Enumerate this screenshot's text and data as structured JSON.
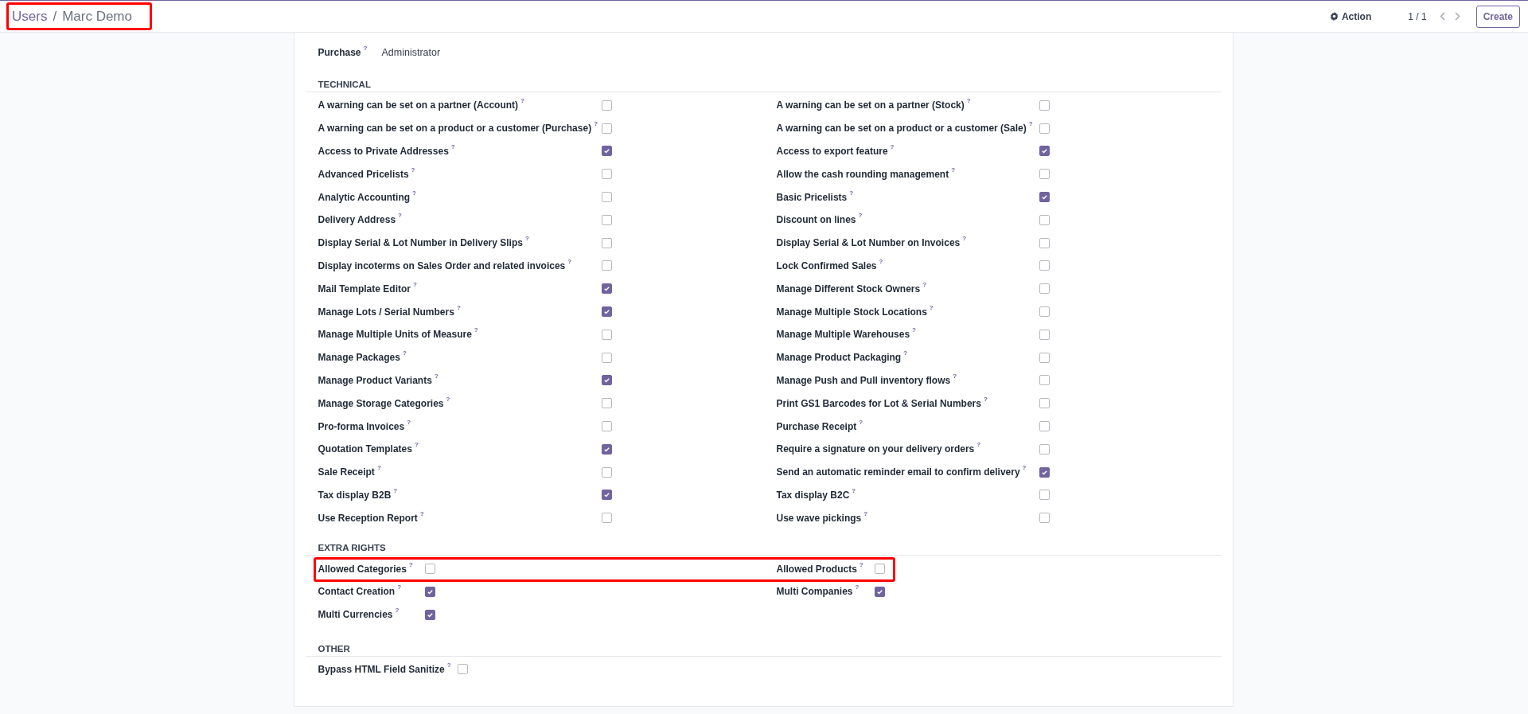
{
  "breadcrumb": {
    "highlighted": true,
    "items": [
      {
        "kind": "link",
        "text": "Users"
      },
      {
        "kind": "separator",
        "text": "/"
      },
      {
        "kind": "current",
        "text": "Marc Demo"
      }
    ]
  },
  "toolbar": {
    "action": "Action",
    "pager": "1 / 1",
    "create": "Create"
  },
  "purchase": {
    "label": "Purchase",
    "help": "?",
    "value": "Administrator"
  },
  "sections": [
    {
      "title": "TECHNICAL",
      "rows": [
        {
          "highlighted": false,
          "fields": [
            {
              "label": "A warning can be set on a partner (Account)",
              "help": "?",
              "checked": false
            },
            {
              "label": "A warning can be set on a partner (Stock)",
              "help": "?",
              "checked": false
            }
          ]
        },
        {
          "highlighted": false,
          "fields": [
            {
              "label": "A warning can be set on a product or a customer (Purchase)",
              "help": "?",
              "checked": false
            },
            {
              "label": "A warning can be set on a product or a customer (Sale)",
              "help": "?",
              "checked": false
            }
          ]
        },
        {
          "highlighted": false,
          "fields": [
            {
              "label": "Access to Private Addresses",
              "help": "?",
              "checked": true
            },
            {
              "label": "Access to export feature",
              "help": "?",
              "checked": true
            }
          ]
        },
        {
          "highlighted": false,
          "fields": [
            {
              "label": "Advanced Pricelists",
              "help": "?",
              "checked": false
            },
            {
              "label": "Allow the cash rounding management",
              "help": "?",
              "checked": false
            }
          ]
        },
        {
          "highlighted": false,
          "fields": [
            {
              "label": "Analytic Accounting",
              "help": "?",
              "checked": false
            },
            {
              "label": "Basic Pricelists",
              "help": "?",
              "checked": true
            }
          ]
        },
        {
          "highlighted": false,
          "fields": [
            {
              "label": "Delivery Address",
              "help": "?",
              "checked": false
            },
            {
              "label": "Discount on lines",
              "help": "?",
              "checked": false
            }
          ]
        },
        {
          "highlighted": false,
          "fields": [
            {
              "label": "Display Serial & Lot Number in Delivery Slips",
              "help": "?",
              "checked": false
            },
            {
              "label": "Display Serial & Lot Number on Invoices",
              "help": "?",
              "checked": false
            }
          ]
        },
        {
          "highlighted": false,
          "fields": [
            {
              "label": "Display incoterms on Sales Order and related invoices",
              "help": "?",
              "checked": false
            },
            {
              "label": "Lock Confirmed Sales",
              "help": "?",
              "checked": false
            }
          ]
        },
        {
          "highlighted": false,
          "fields": [
            {
              "label": "Mail Template Editor",
              "help": "?",
              "checked": true
            },
            {
              "label": "Manage Different Stock Owners",
              "help": "?",
              "checked": false
            }
          ]
        },
        {
          "highlighted": false,
          "fields": [
            {
              "label": "Manage Lots / Serial Numbers",
              "help": "?",
              "checked": true
            },
            {
              "label": "Manage Multiple Stock Locations",
              "help": "?",
              "checked": false
            }
          ]
        },
        {
          "highlighted": false,
          "fields": [
            {
              "label": "Manage Multiple Units of Measure",
              "help": "?",
              "checked": false
            },
            {
              "label": "Manage Multiple Warehouses",
              "help": "?",
              "checked": false
            }
          ]
        },
        {
          "highlighted": false,
          "fields": [
            {
              "label": "Manage Packages",
              "help": "?",
              "checked": false
            },
            {
              "label": "Manage Product Packaging",
              "help": "?",
              "checked": false
            }
          ]
        },
        {
          "highlighted": false,
          "fields": [
            {
              "label": "Manage Product Variants",
              "help": "?",
              "checked": true
            },
            {
              "label": "Manage Push and Pull inventory flows",
              "help": "?",
              "checked": false
            }
          ]
        },
        {
          "highlighted": false,
          "fields": [
            {
              "label": "Manage Storage Categories",
              "help": "?",
              "checked": false
            },
            {
              "label": "Print GS1 Barcodes for Lot & Serial Numbers",
              "help": "?",
              "checked": false
            }
          ]
        },
        {
          "highlighted": false,
          "fields": [
            {
              "label": "Pro-forma Invoices",
              "help": "?",
              "checked": false
            },
            {
              "label": "Purchase Receipt",
              "help": "?",
              "checked": false
            }
          ]
        },
        {
          "highlighted": false,
          "fields": [
            {
              "label": "Quotation Templates",
              "help": "?",
              "checked": true
            },
            {
              "label": "Require a signature on your delivery orders",
              "help": "?",
              "checked": false
            }
          ]
        },
        {
          "highlighted": false,
          "fields": [
            {
              "label": "Sale Receipt",
              "help": "?",
              "checked": false
            },
            {
              "label": "Send an automatic reminder email to confirm delivery",
              "help": "?",
              "checked": true
            }
          ]
        },
        {
          "highlighted": false,
          "fields": [
            {
              "label": "Tax display B2B",
              "help": "?",
              "checked": true
            },
            {
              "label": "Tax display B2C",
              "help": "?",
              "checked": false
            }
          ]
        },
        {
          "highlighted": false,
          "fields": [
            {
              "label": "Use Reception Report",
              "help": "?",
              "checked": false
            },
            {
              "label": "Use wave pickings",
              "help": "?",
              "checked": false
            }
          ]
        }
      ]
    },
    {
      "title": "EXTRA RIGHTS",
      "rows": [
        {
          "highlighted": true,
          "fields": [
            {
              "label": "Allowed Categories",
              "help": "?",
              "checked": false
            },
            {
              "label": "Allowed Products",
              "help": "?",
              "checked": false
            }
          ]
        },
        {
          "highlighted": false,
          "fields": [
            {
              "label": "Contact Creation",
              "help": "?",
              "checked": true
            },
            {
              "label": "Multi Companies",
              "help": "?",
              "checked": true
            }
          ]
        },
        {
          "highlighted": false,
          "fields": [
            {
              "label": "Multi Currencies",
              "help": "?",
              "checked": true
            }
          ]
        }
      ]
    },
    {
      "title": "OTHER",
      "rows": [
        {
          "highlighted": false,
          "fields": [
            {
              "label": "Bypass HTML Field Sanitize",
              "help": "?",
              "checked": false
            }
          ]
        }
      ]
    }
  ]
}
